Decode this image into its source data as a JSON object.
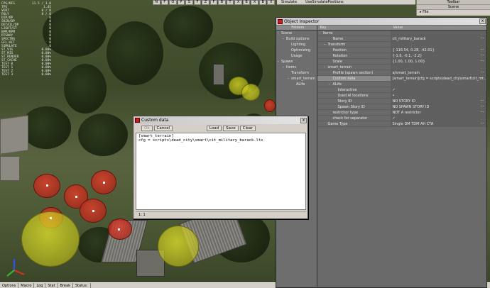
{
  "stats": [
    {
      "k": "FPS/RFS",
      "v": "11.5 / 1.0"
    },
    {
      "k": "TPS",
      "v": "1.45"
    },
    {
      "k": "VERT",
      "v": "0 / 0"
    },
    {
      "k": "POLY",
      "v": "0 / 0"
    },
    {
      "k": "DIP/DP",
      "v": "0"
    },
    {
      "k": "SKIN/DP",
      "v": "0"
    },
    {
      "k": "DETAIL/DP",
      "v": "0"
    },
    {
      "k": "LIGHT/ST",
      "v": "0"
    },
    {
      "k": "BPM/RPM",
      "v": "0"
    },
    {
      "k": "RTSWAY",
      "v": "0"
    },
    {
      "k": "SPECTRA",
      "v": "0"
    },
    {
      "k": "GFL:ACT",
      "v": "0"
    },
    {
      "k": "SIMULATE",
      "v": "0"
    },
    {
      "k": "ST_VIS",
      "v": "0.00%"
    },
    {
      "k": "ST_MIS",
      "v": "0.00%"
    },
    {
      "k": "ST_RENDER",
      "v": "0.00%"
    },
    {
      "k": "ST_CACHE",
      "v": "0.00%"
    },
    {
      "k": "TEST 0",
      "v": "0.00%"
    },
    {
      "k": "TEST 1",
      "v": "0.00%"
    },
    {
      "k": "TEST 2",
      "v": "0.00%"
    },
    {
      "k": "TEST 3",
      "v": "0.00%"
    }
  ],
  "viewport_toolbar": [
    "N",
    "F",
    "O",
    "P",
    "S",
    "F",
    "Z",
    "F",
    "B",
    "T",
    "X",
    "B",
    "X",
    "B",
    "X"
  ],
  "top_menu": [
    "Simulate",
    "UseSimulatePositions"
  ],
  "right_panel": {
    "title": "Toolbar",
    "section": "Scene",
    "file_label": "File"
  },
  "status_bar": [
    "Options",
    "Macro",
    "Log",
    "Stat",
    "Break",
    "Status:"
  ],
  "inspector": {
    "title": "Object Inspector",
    "close": "x",
    "folders_header": "Folders",
    "key_header": "Key",
    "value_header": "Value",
    "folders": [
      {
        "label": "Scene",
        "indent": 0,
        "exp": "-"
      },
      {
        "label": "Build options",
        "indent": 1,
        "exp": "-"
      },
      {
        "label": "Lighting",
        "indent": 2,
        "exp": ""
      },
      {
        "label": "Optimizing",
        "indent": 2,
        "exp": ""
      },
      {
        "label": "Usage",
        "indent": 2,
        "exp": ""
      },
      {
        "label": "Spawn",
        "indent": 0,
        "exp": "-"
      },
      {
        "label": "Items",
        "indent": 1,
        "exp": "-"
      },
      {
        "label": "Transform",
        "indent": 2,
        "exp": ""
      },
      {
        "label": "smart_terrain",
        "indent": 2,
        "exp": "-"
      },
      {
        "label": "ALife",
        "indent": 3,
        "exp": ""
      }
    ],
    "props": [
      {
        "k": "Items",
        "v": "",
        "indent": 0,
        "exp": "-"
      },
      {
        "k": "Name",
        "v": "cit_military_barack",
        "indent": 2,
        "exp": "",
        "btn": "..."
      },
      {
        "k": "Transform",
        "v": "",
        "indent": 1,
        "exp": "-"
      },
      {
        "k": "Position",
        "v": "{-116.54, 0.28, -42.01}",
        "indent": 2,
        "exp": "",
        "btn": "..."
      },
      {
        "k": "Rotation",
        "v": "{-1.6, -0.1, -2.2}",
        "indent": 2,
        "exp": "",
        "btn": "..."
      },
      {
        "k": "Scale",
        "v": "{1.00, 1.00, 1.00}",
        "indent": 2,
        "exp": "",
        "btn": "..."
      },
      {
        "k": "smart_terrain",
        "v": "",
        "indent": 1,
        "exp": "-"
      },
      {
        "k": "Profile (spawn section)",
        "v": "a/smart_terrain",
        "indent": 2,
        "exp": "",
        "btn": "..."
      },
      {
        "k": "Custom data",
        "v": "[smart_terrain]cfg = scripts\\dead_city\\smart\\cit_mi...",
        "indent": 2,
        "exp": "",
        "btn": "...",
        "sel": true
      },
      {
        "k": "ALife",
        "v": "",
        "indent": 2,
        "exp": "-"
      },
      {
        "k": "Interactive",
        "v": "✓",
        "indent": 3,
        "exp": ""
      },
      {
        "k": "Used AI locations",
        "v": "•",
        "indent": 3,
        "exp": ""
      },
      {
        "k": "Story ID",
        "v": "NO STORY ID",
        "indent": 3,
        "exp": "",
        "btn": "..."
      },
      {
        "k": "Spawn Story ID",
        "v": "NO SPAWN STORY ID",
        "indent": 3,
        "exp": "",
        "btn": "..."
      },
      {
        "k": "restrictor type",
        "v": "NOT A restrictor",
        "indent": 2,
        "exp": "",
        "btn": "..."
      },
      {
        "k": "check for separator",
        "v": "✓",
        "indent": 2,
        "exp": ""
      },
      {
        "k": "Game Type",
        "v": "Single DM TDM AH CTA",
        "indent": 1,
        "exp": "",
        "btn": "..."
      }
    ]
  },
  "dialog": {
    "title": "Custom data",
    "close": "x",
    "ok": "Ok",
    "cancel": "Cancel",
    "load": "Load",
    "save": "Save",
    "clear": "Clear",
    "lines": [
      "[smart_terrain]",
      "cfg = scripts\\dead_city\\smart\\cit_military_barack.ltx"
    ],
    "cursor": "1:  1"
  }
}
